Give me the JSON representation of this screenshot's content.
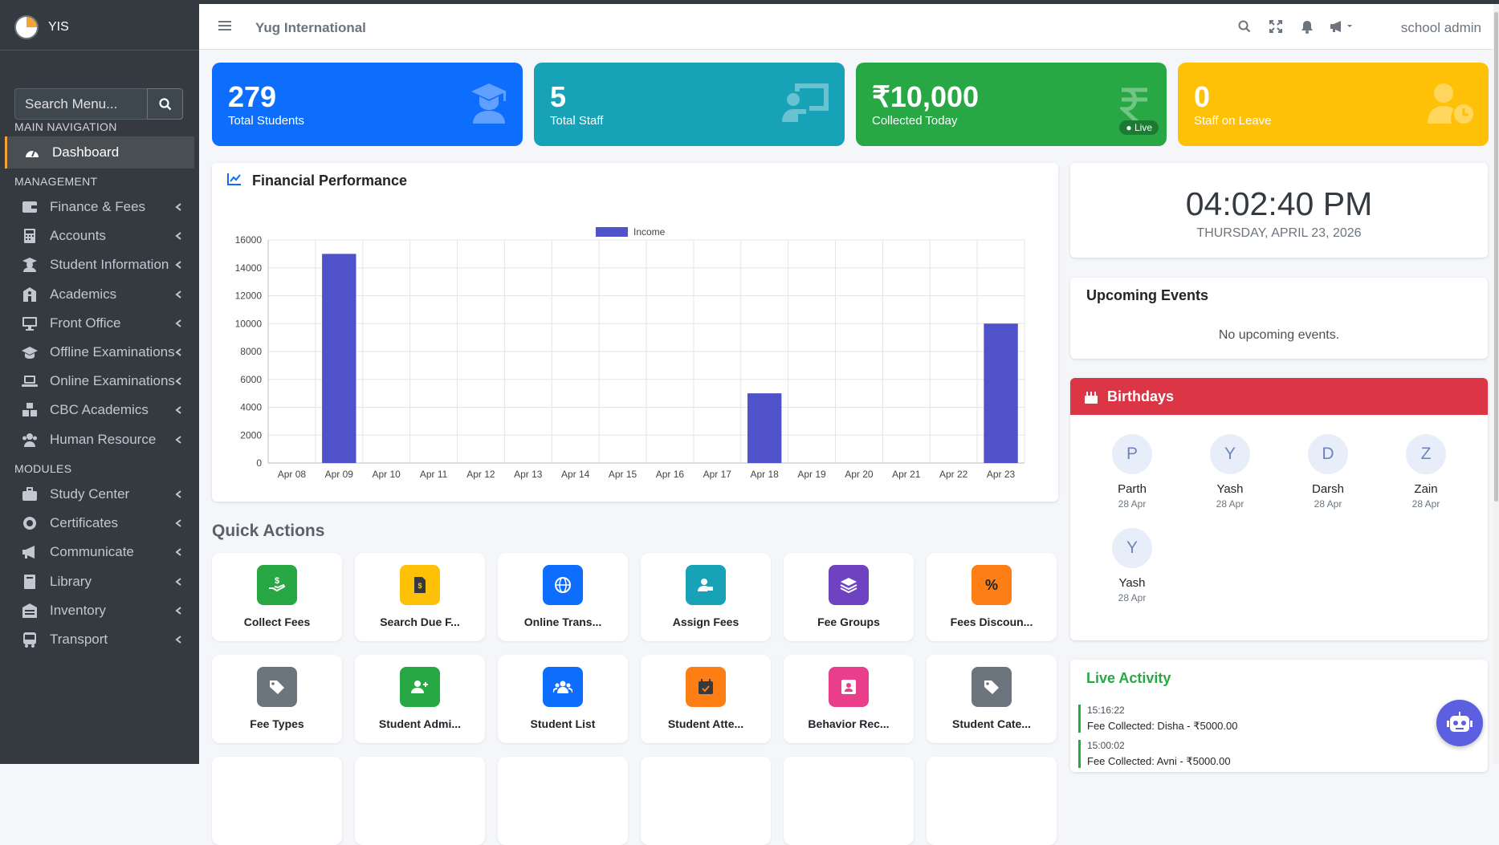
{
  "brand": {
    "name": "YIS"
  },
  "sidebar": {
    "search_placeholder": "Search Menu...",
    "headers": {
      "main": "MAIN NAVIGATION",
      "management": "MANAGEMENT",
      "modules": "MODULES"
    },
    "dashboard": "Dashboard",
    "management_items": [
      {
        "label": "Finance & Fees",
        "icon": "wallet-icon"
      },
      {
        "label": "Accounts",
        "icon": "calculator-icon"
      },
      {
        "label": "Student Information",
        "icon": "graduate-icon"
      },
      {
        "label": "Academics",
        "icon": "school-icon"
      },
      {
        "label": "Front Office",
        "icon": "desktop-icon"
      },
      {
        "label": "Offline Examinations",
        "icon": "graduation-cap-icon"
      },
      {
        "label": "Online Examinations",
        "icon": "laptop-icon"
      },
      {
        "label": "CBC Academics",
        "icon": "cubes-icon"
      },
      {
        "label": "Human Resource",
        "icon": "users-icon"
      }
    ],
    "module_items": [
      {
        "label": "Study Center",
        "icon": "briefcase-icon"
      },
      {
        "label": "Certificates",
        "icon": "certificate-icon"
      },
      {
        "label": "Communicate",
        "icon": "bullhorn-icon"
      },
      {
        "label": "Library",
        "icon": "book-icon"
      },
      {
        "label": "Inventory",
        "icon": "warehouse-icon"
      },
      {
        "label": "Transport",
        "icon": "bus-icon"
      }
    ]
  },
  "topbar": {
    "title": "Yug International",
    "user": "school admin"
  },
  "stats": [
    {
      "value": "279",
      "label": "Total Students",
      "color": "#0d6efd"
    },
    {
      "value": "5",
      "label": "Total Staff",
      "color": "#17a2b8"
    },
    {
      "value": "₹10,000",
      "label": "Collected Today",
      "badge": "● Live",
      "color": "#28a745"
    },
    {
      "value": "0",
      "label": "Staff on Leave",
      "color": "#ffc107"
    }
  ],
  "finance": {
    "title": "Financial Performance"
  },
  "chart_data": {
    "type": "bar",
    "title": "",
    "legend": [
      "Income"
    ],
    "categories": [
      "Apr 08",
      "Apr 09",
      "Apr 10",
      "Apr 11",
      "Apr 12",
      "Apr 13",
      "Apr 14",
      "Apr 15",
      "Apr 16",
      "Apr 17",
      "Apr 18",
      "Apr 19",
      "Apr 20",
      "Apr 21",
      "Apr 22",
      "Apr 23"
    ],
    "series": [
      {
        "name": "Income",
        "values": [
          0,
          15000,
          0,
          0,
          0,
          0,
          0,
          0,
          0,
          0,
          5000,
          0,
          0,
          0,
          0,
          10000
        ],
        "color": "#4f52c9"
      }
    ],
    "ylim": [
      0,
      16000
    ],
    "yticks": [
      0,
      2000,
      4000,
      6000,
      8000,
      10000,
      12000,
      14000,
      16000
    ],
    "grid": true,
    "legend_position": "top-center"
  },
  "quick_actions": {
    "title": "Quick Actions",
    "items": [
      {
        "label": "Collect Fees",
        "color": "#28a745",
        "icon": "hand-money-icon"
      },
      {
        "label": "Search Due F...",
        "color": "#ffc107",
        "icon": "invoice-icon"
      },
      {
        "label": "Online Trans...",
        "color": "#0d6efd",
        "icon": "globe-icon"
      },
      {
        "label": "Assign Fees",
        "color": "#17a2b8",
        "icon": "user-tag-icon"
      },
      {
        "label": "Fee Groups",
        "color": "#6f42c1",
        "icon": "layers-icon"
      },
      {
        "label": "Fees Discoun...",
        "color": "#fd7e14",
        "icon": "percent-icon"
      },
      {
        "label": "Fee Types",
        "color": "#6c757d",
        "icon": "tags-icon"
      },
      {
        "label": "Student Admi...",
        "color": "#28a745",
        "icon": "user-plus-icon"
      },
      {
        "label": "Student List",
        "color": "#0d6efd",
        "icon": "users-icon"
      },
      {
        "label": "Student Atte...",
        "color": "#fd7e14",
        "icon": "calendar-check-icon"
      },
      {
        "label": "Behavior Rec...",
        "color": "#e83e8c",
        "icon": "id-card-icon"
      },
      {
        "label": "Student Cate...",
        "color": "#6c757d",
        "icon": "tags-icon"
      }
    ]
  },
  "clock": {
    "time": "04:02:40 PM",
    "date": "THURSDAY, APRIL 23, 2026"
  },
  "events": {
    "title": "Upcoming Events",
    "empty": "No upcoming events."
  },
  "birthdays": {
    "title": "Birthdays",
    "people": [
      {
        "initial": "P",
        "name": "Parth",
        "date": "28 Apr"
      },
      {
        "initial": "Y",
        "name": "Yash",
        "date": "28 Apr"
      },
      {
        "initial": "D",
        "name": "Darsh",
        "date": "28 Apr"
      },
      {
        "initial": "Z",
        "name": "Zain",
        "date": "28 Apr"
      },
      {
        "initial": "Y",
        "name": "Yash",
        "date": "28 Apr"
      }
    ]
  },
  "activity": {
    "title": "Live Activity",
    "items": [
      {
        "time": "15:16:22",
        "text": "Fee Collected: Disha - ₹5000.00"
      },
      {
        "time": "15:00:02",
        "text": "Fee Collected: Avni - ₹5000.00"
      }
    ]
  }
}
